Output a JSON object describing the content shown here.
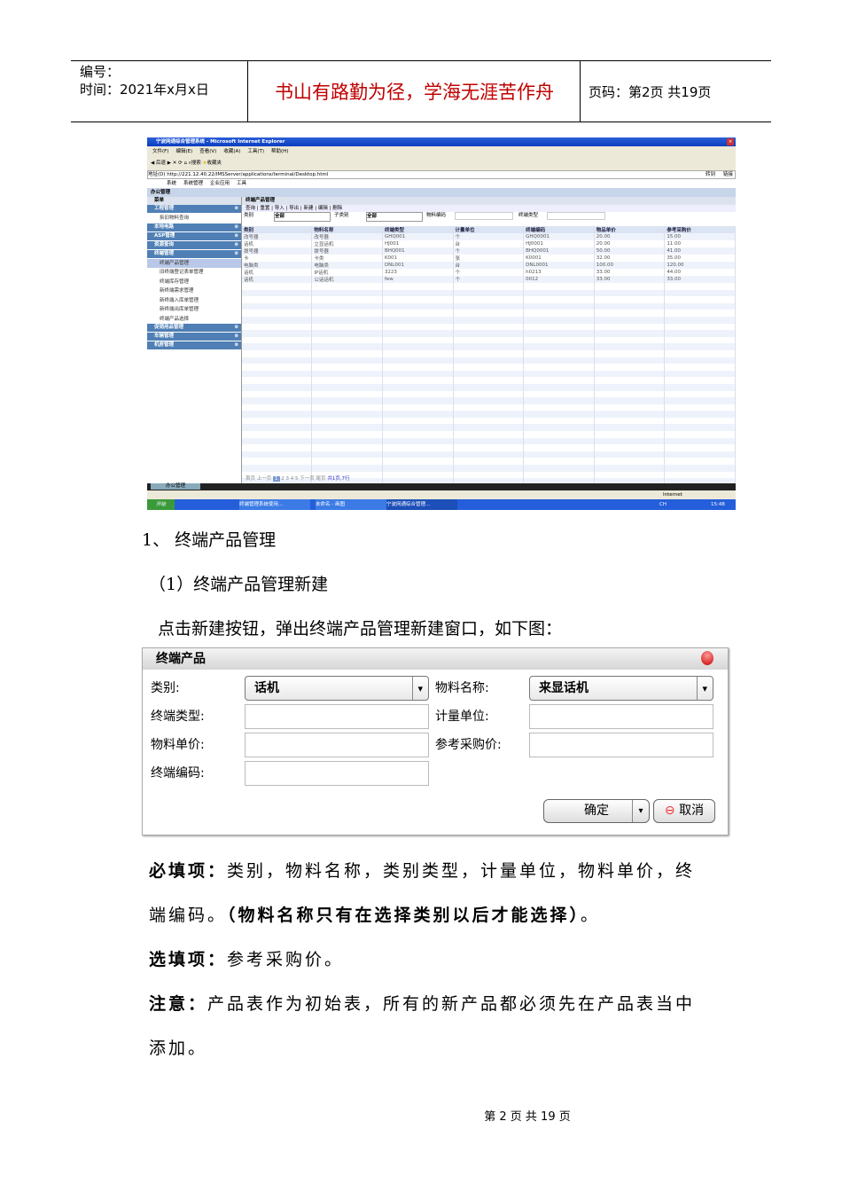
{
  "header": {
    "number_label": "编号：",
    "time_label": "时间：2021年x月x日",
    "motto": "书山有路勤为径，学海无涯苦作舟",
    "page_label": "页码：第2页  共19页"
  },
  "screenshot": {
    "window_title": "宁波网通综合管理系统 - Microsoft Internet Explorer",
    "menu": [
      "文件(F)",
      "编辑(E)",
      "查看(V)",
      "收藏(A)",
      "工具(T)",
      "帮助(H)"
    ],
    "toolbar": [
      "后退",
      "搜索",
      "收藏夹"
    ],
    "address_label": "地址(D)",
    "address": "http://221.12.40.22/IMSServer/applications/terminal/Desktop.html",
    "go": "转到",
    "links": "链接",
    "top_nav": [
      "系统",
      "系统管理",
      "企业应用",
      "工具"
    ],
    "section": "办公管理",
    "sidebar": {
      "title": "菜单",
      "groups": [
        {
          "label": "工程管理",
          "items": [
            "拆旧物料查询"
          ]
        },
        {
          "label": "本地电路",
          "items": []
        },
        {
          "label": "ASP管理",
          "items": []
        },
        {
          "label": "资源查询",
          "items": []
        },
        {
          "label": "终端管理",
          "items": [
            "终端产品管理",
            "旧终端登记表单管理",
            "终端库存管理",
            "新终端需求管理",
            "新终端入库单管理",
            "新终端出库单管理",
            "终端产品选择"
          ]
        },
        {
          "label": "促销用品管理",
          "items": []
        },
        {
          "label": "车辆管理",
          "items": []
        },
        {
          "label": "机房管理",
          "items": []
        }
      ]
    },
    "panel_title": "终端产品管理",
    "actions": [
      "查询",
      "重置",
      "导入",
      "导出",
      "新建",
      "编辑",
      "删除"
    ],
    "filters": {
      "category_label": "类别",
      "category": "全部",
      "subcategory_label": "子类别",
      "subcategory": "全部",
      "code_label": "物料编码",
      "type_label": "终端类型"
    },
    "table": {
      "columns": [
        "类别",
        "物料名称",
        "终端类型",
        "计量单位",
        "终端编码",
        "物品单价",
        "参考采购价"
      ],
      "rows": [
        [
          "改号器",
          "改号器",
          "GHQ001",
          "个",
          "GHQ0001",
          "20.00",
          "15.00"
        ],
        [
          "话机",
          "立显话机",
          "HJ001",
          "台",
          "HJ0001",
          "20.00",
          "11.00"
        ],
        [
          "拨号器",
          "拨号器",
          "BHQ001",
          "个",
          "BHQ0001",
          "50.00",
          "41.00"
        ],
        [
          "卡",
          "卡类",
          "K001",
          "张",
          "K0001",
          "32.00",
          "35.00"
        ],
        [
          "电脑类",
          "电脑类",
          "DNL001",
          "台",
          "DNL0001",
          "100.00",
          "120.00"
        ],
        [
          "话机",
          "IP话机",
          "3223",
          "个",
          "h0213",
          "33.00",
          "44.00"
        ],
        [
          "话机",
          "公话话机",
          "few",
          "个",
          "0012",
          "33.00",
          "33.00"
        ]
      ]
    },
    "pager": {
      "first": "首页",
      "prev": "上一页",
      "pages": [
        "1",
        "2",
        "3",
        "4",
        "5"
      ],
      "next": "下一页",
      "last": "尾页",
      "summary": "共1页,7行"
    },
    "bottom_tab": "办公管理",
    "status_zone": "Internet",
    "taskbar": {
      "start": "开始",
      "tasks": [
        "终端管理系统使用...",
        "未命名 - 画图",
        "宁波网通综合管理..."
      ],
      "lang": "CH",
      "clock": "15:48"
    }
  },
  "section_heading": "1、   终端产品管理",
  "sub_heading": "（1）终端产品管理新建",
  "intro": "点击新建按钮，弹出终端产品管理新建窗口，如下图：",
  "dialog": {
    "title": "终端产品",
    "category_label": "类别:",
    "category": "话机",
    "material_label": "物料名称:",
    "material": "来显话机",
    "type_label": "终端类型:",
    "unit_label": "计量单位:",
    "price_label": "物料单价:",
    "ref_price_label": "参考采购价:",
    "code_label": "终端编码:",
    "ok": "确定",
    "cancel": "取消"
  },
  "notes": {
    "required_label": "必填项：",
    "required_text": "类别，物料名称，类别类型，计量单位，物料单价，终",
    "required_text2": "端编码。",
    "required_bold": "（物料名称只有在选择类别以后才能选择）",
    "required_end": "。",
    "optional_label": "选填项：",
    "optional_text": "参考采购价。",
    "note_label": "注意：",
    "note_text": "产品表作为初始表，所有的新产品都必须先在产品表当中",
    "note_text2": "添加。"
  },
  "footer": "第 2 页 共 19 页"
}
